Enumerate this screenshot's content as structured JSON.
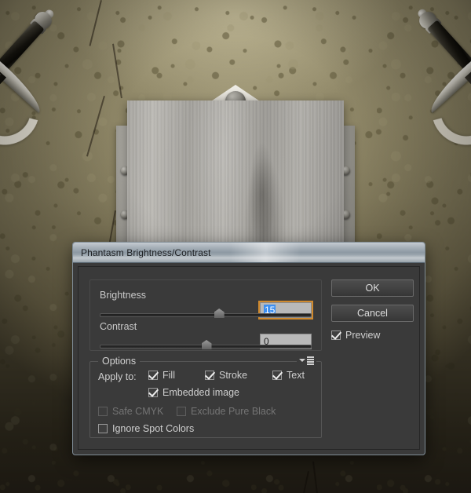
{
  "scene": {
    "description": "Stone wall background with two crossed swords and a wooden shield plaque",
    "wall_color": "#837b5c",
    "wall_dark_color": "#3d3526",
    "sword_blade_color": "#1b1913",
    "sword_hilt_color": "#d8d5cc",
    "wood_color": "#a9a7a2",
    "metal_color": "#cbc9c2"
  },
  "dialog": {
    "title": "Phantasm Brightness/Contrast",
    "sliders": [
      {
        "label": "Brightness",
        "value": "15",
        "value_selected": true,
        "focused": true,
        "thumb_percent": 56
      },
      {
        "label": "Contrast",
        "value": "0",
        "value_selected": false,
        "focused": false,
        "thumb_percent": 50
      }
    ],
    "buttons": {
      "ok_label": "OK",
      "cancel_label": "Cancel"
    },
    "preview": {
      "label": "Preview",
      "checked": true
    },
    "options": {
      "legend": "Options",
      "flyout_icon": "flyout-menu-icon",
      "apply_to_label": "Apply to:",
      "apply_to": [
        {
          "label": "Fill",
          "checked": true,
          "enabled": true
        },
        {
          "label": "Stroke",
          "checked": true,
          "enabled": true
        },
        {
          "label": "Text",
          "checked": true,
          "enabled": true
        }
      ],
      "embedded": {
        "label": "Embedded image",
        "checked": true,
        "enabled": true
      },
      "color_options": [
        {
          "label": "Safe CMYK",
          "checked": false,
          "enabled": false
        },
        {
          "label": "Exclude Pure Black",
          "checked": false,
          "enabled": false
        }
      ],
      "spot": {
        "label": "Ignore Spot Colors",
        "checked": false,
        "enabled": true
      }
    },
    "colors": {
      "accent_focus": "#d08a2e",
      "selection_blue": "#3d8ff0",
      "panel_bg": "#3a3a3a",
      "titlebar": "#8d99a3",
      "field_bg": "#b9b9b9"
    }
  }
}
